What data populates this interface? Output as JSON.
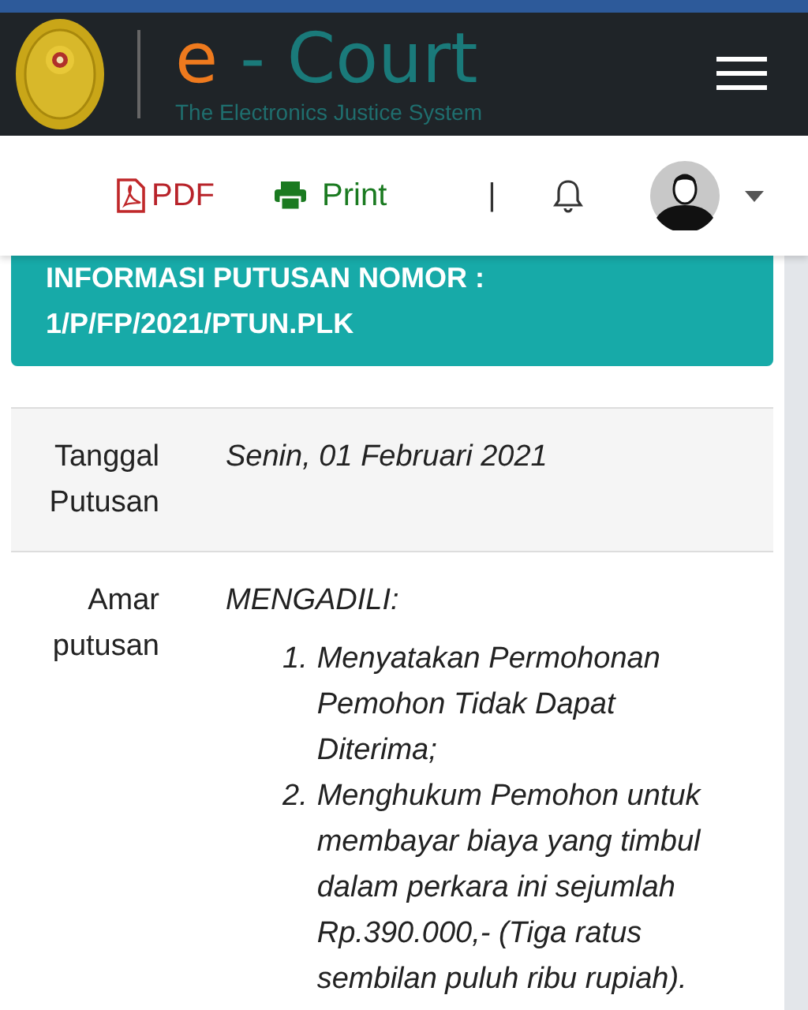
{
  "header": {
    "logo_e": "e",
    "logo_rest": " - Court",
    "tagline": "The Electronics Justice System"
  },
  "toolbar": {
    "pdf": "PDF",
    "print": "Print",
    "separator": "|"
  },
  "card": {
    "title_line1": "INFORMASI PUTUSAN NOMOR :",
    "title_line2": "1/P/FP/2021/PTUN.PLK"
  },
  "rows": [
    {
      "label": "Tanggal Putusan",
      "kind": "text",
      "value": "Senin, 01 Februari 2021"
    },
    {
      "label": "Amar putusan",
      "kind": "list",
      "value": "MENGADILI:",
      "items": [
        {
          "number": "1.",
          "text": "Menyatakan Permohonan Pemohon Tidak Dapat Diterima;"
        },
        {
          "number": "2.",
          "text": "Menghukum Pemohon untuk membayar biaya yang timbul dalam perkara ini sejumlah Rp.390.000,- (Tiga ratus sembilan puluh ribu rupiah)."
        }
      ]
    }
  ]
}
